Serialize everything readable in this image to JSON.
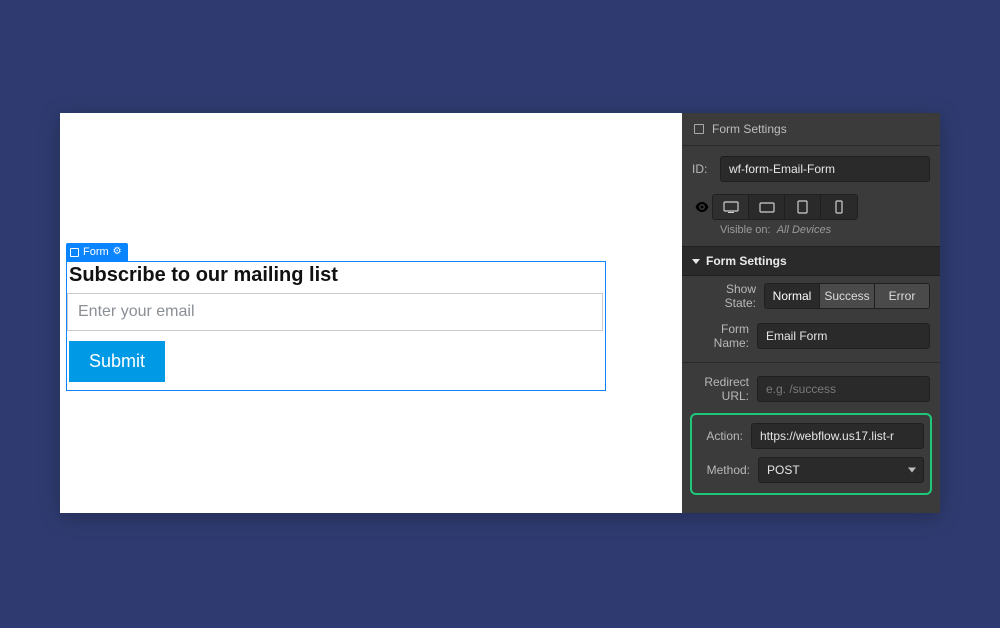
{
  "canvas": {
    "selection_tag": "Form",
    "form_heading": "Subscribe to our mailing list",
    "email_placeholder": "Enter your email",
    "submit_label": "Submit"
  },
  "inspector": {
    "title": "Form Settings",
    "id_label": "ID:",
    "id_value": "wf-form-Email-Form",
    "visible_on_label": "Visible on:",
    "visible_on_value": "All Devices",
    "section_header": "Form Settings",
    "show_state": {
      "label": "Show State:",
      "options": [
        "Normal",
        "Success",
        "Error"
      ],
      "active": "Normal"
    },
    "form_name": {
      "label": "Form Name:",
      "value": "Email Form"
    },
    "redirect": {
      "label": "Redirect URL:",
      "placeholder": "e.g. /success",
      "value": ""
    },
    "action": {
      "label": "Action:",
      "value": "https://webflow.us17.list-r"
    },
    "method": {
      "label": "Method:",
      "value": "POST"
    }
  }
}
